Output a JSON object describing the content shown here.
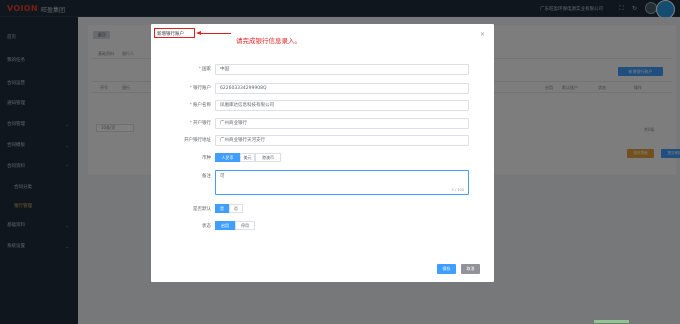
{
  "topbar": {
    "logo": "VOION",
    "logo_cn": "旺盈集团",
    "company": "广东旺盈环保电源实业有限公司",
    "icons": [
      "expand-icon",
      "refresh-icon",
      "bell-icon"
    ]
  },
  "sidebar": {
    "items": [
      {
        "label": "首页"
      },
      {
        "label": "我的任务"
      },
      {
        "label": "合同运营"
      },
      {
        "label": "通知管理"
      },
      {
        "label": "合同管理"
      },
      {
        "label": "合同模板"
      },
      {
        "label": "合同资料"
      },
      {
        "label": "合同分类"
      },
      {
        "label": "银行管理"
      },
      {
        "label": "基础资料"
      },
      {
        "label": "系统设置"
      }
    ]
  },
  "background": {
    "back_label": "返回",
    "tabs": [
      "基础资料",
      "银行人"
    ],
    "add_label": "新增银行账户",
    "headers": [
      "序号",
      "银行",
      "启用",
      "默认账户",
      "状态",
      "操作"
    ],
    "page_size": "10条/页",
    "total": "共0条",
    "orange_label": "保存草稿",
    "blue_label": "提交审核"
  },
  "dialog": {
    "title": "新增银行账户",
    "annotation": "请完成银行信息录入。",
    "fields": {
      "country_label": "国家",
      "country_value": "中国",
      "account_label": "银行账户",
      "account_value": "622603334299908Q",
      "account_name_label": "账户名称",
      "account_name_value": "凤凰库达信息科技有限公司",
      "bank_label": "开户银行",
      "bank_value": "广州商业银行",
      "address_label": "开户银行地址",
      "address_value": "广州商业银行天河支行",
      "currency_label": "币种",
      "currency_options": [
        "人民币",
        "美元",
        "港澳币"
      ],
      "currency_selected": "人民币",
      "remark_label": "备注",
      "remark_value": "可",
      "remark_count": "1 / 100",
      "default_label": "是否默认",
      "default_options": [
        "是",
        "否"
      ],
      "default_selected": "是",
      "status_label": "状态",
      "status_options": [
        "启用",
        "停用"
      ],
      "status_selected": "启用"
    },
    "save_label": "保存",
    "cancel_label": "取消"
  },
  "colors": {
    "primary": "#409eff",
    "annotation_red": "#e02020",
    "sidebar_bg": "#1f2d3d",
    "sidebar_active": "#e3b55a",
    "warning": "#e6a23c"
  }
}
